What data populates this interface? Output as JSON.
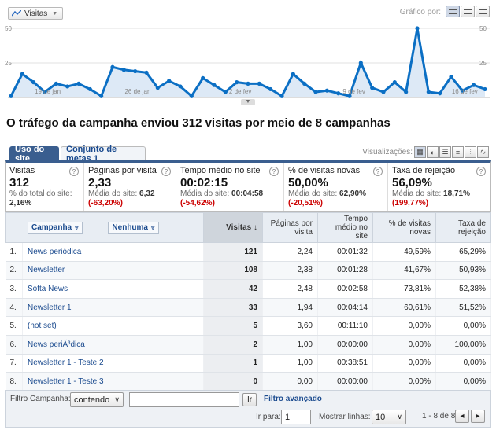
{
  "graph": {
    "metric_label": "Visitas",
    "graph_by_label": "Gráfico por:",
    "y_max_label": "50",
    "y_mid_label": "25",
    "y_max_right": "50",
    "y_mid_right": "25",
    "line_color": "#0b6fc4",
    "fill_color": "#dde9f6"
  },
  "chart_data": {
    "type": "area",
    "x_tick_labels": [
      "19 de jan",
      "26 de jan",
      "2 de fev",
      "9 de fev",
      "16 de fev"
    ],
    "y_ticks": [
      25,
      50
    ],
    "ylim": [
      0,
      50
    ],
    "values": [
      1,
      17,
      11,
      4,
      10,
      8,
      10,
      6,
      1,
      22,
      20,
      19,
      18,
      7,
      12,
      8,
      1,
      14,
      9,
      4,
      11,
      10,
      10,
      6,
      1,
      17,
      10,
      4,
      5,
      3,
      1,
      25,
      7,
      4,
      11,
      4,
      50,
      4,
      3,
      15,
      5,
      9,
      6
    ]
  },
  "title": "O tráfego da campanha enviou 312 visitas por meio de 8 campanhas",
  "tabs": [
    {
      "label": "Uso do site"
    },
    {
      "label": "Conjunto de metas 1"
    }
  ],
  "views_label": "Visualizações:",
  "summary": [
    {
      "label": "Visitas",
      "value": "312",
      "sub1": "% do total do site:",
      "sub2": "2,16%",
      "diff": ""
    },
    {
      "label": "Páginas por visita",
      "value": "2,33",
      "sub1": "Média do site:",
      "sub2": "6,32",
      "diff": "(-63,20%)"
    },
    {
      "label": "Tempo médio no site",
      "value": "00:02:15",
      "sub1": "Média do site:",
      "sub2": "00:04:58",
      "diff": "(-54,62%)"
    },
    {
      "label": "% de visitas novas",
      "value": "50,00%",
      "sub1": "Média do site:",
      "sub2": "62,90%",
      "diff": "(-20,51%)"
    },
    {
      "label": "Taxa de rejeição",
      "value": "56,09%",
      "sub1": "Média do site:",
      "sub2": "18,71%",
      "diff": "(199,77%)"
    }
  ],
  "table": {
    "dimension_primary": "Campanha",
    "dimension_secondary": "Nenhuma",
    "headers": [
      "Visitas ↓",
      "Páginas por visita",
      "Tempo médio no site",
      "% de visitas novas",
      "Taxa de rejeição"
    ],
    "rows": [
      {
        "n": "1.",
        "name": "News periódica",
        "v": "121",
        "p": "2,24",
        "t": "00:01:32",
        "nv": "49,59%",
        "tr": "65,29%"
      },
      {
        "n": "2.",
        "name": "Newsletter",
        "v": "108",
        "p": "2,38",
        "t": "00:01:28",
        "nv": "41,67%",
        "tr": "50,93%"
      },
      {
        "n": "3.",
        "name": "Softa News",
        "v": "42",
        "p": "2,48",
        "t": "00:02:58",
        "nv": "73,81%",
        "tr": "52,38%"
      },
      {
        "n": "4.",
        "name": "Newsletter 1",
        "v": "33",
        "p": "1,94",
        "t": "00:04:14",
        "nv": "60,61%",
        "tr": "51,52%"
      },
      {
        "n": "5.",
        "name": "(not set)",
        "v": "5",
        "p": "3,60",
        "t": "00:11:10",
        "nv": "0,00%",
        "tr": "0,00%"
      },
      {
        "n": "6.",
        "name": "News periÃ³dica",
        "v": "2",
        "p": "1,00",
        "t": "00:00:00",
        "nv": "0,00%",
        "tr": "100,00%"
      },
      {
        "n": "7.",
        "name": "Newsletter 1 - Teste 2",
        "v": "1",
        "p": "1,00",
        "t": "00:38:51",
        "nv": "0,00%",
        "tr": "0,00%"
      },
      {
        "n": "8.",
        "name": "Newsletter 1 - Teste 3",
        "v": "0",
        "p": "0,00",
        "t": "00:00:00",
        "nv": "0,00%",
        "tr": "0,00%"
      }
    ]
  },
  "footer": {
    "filter_label": "Filtro Campanha:",
    "filter_mode": "contendo",
    "filter_value": "",
    "go_label": "Ir",
    "advanced_label": "Filtro avançado",
    "goto_label": "Ir para:",
    "goto_value": "1",
    "show_rows_label": "Mostrar linhas:",
    "show_rows_value": "10",
    "range_label": "1 - 8 de 8"
  }
}
